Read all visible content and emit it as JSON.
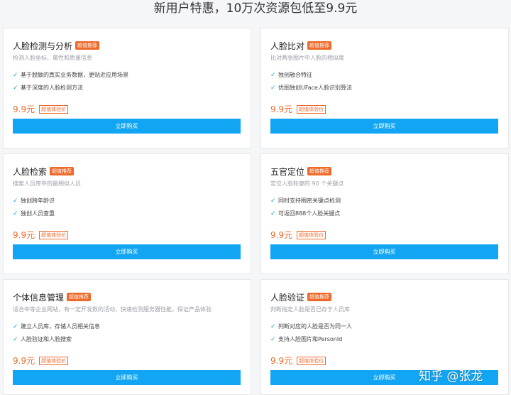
{
  "page": {
    "title": "新用户特惠，10万次资源包低至9.9元"
  },
  "cards": [
    {
      "title": "人脸检测与分析",
      "badge": "超值推荐",
      "subtitle": "检测人脸坐标、属性和质量信息",
      "features": [
        "基于脱敏的真实业务数据，更贴近应用场景",
        "基于深度的人脸检测方法"
      ],
      "price": "9.9元",
      "trial": "超值体验价",
      "button": "立即购买"
    },
    {
      "title": "人脸比对",
      "badge": "超值推荐",
      "subtitle": "比对两张图片中人脸的相似度",
      "features": [
        "独创融合特征",
        "优图独创UFace人脸识别算法"
      ],
      "price": "9.9元",
      "trial": "超值体验价",
      "button": "立即购买"
    },
    {
      "title": "人脸检索",
      "badge": "超值推荐",
      "subtitle": "搜索人员库中的最相似人员",
      "features": [
        "独创跨年龄识",
        "独创人员查重"
      ],
      "price": "9.9元",
      "trial": "超值体验价",
      "button": "立即购买"
    },
    {
      "title": "五官定位",
      "badge": "超值推荐",
      "subtitle": "定位人脸轮廓的 90 个关键点",
      "features": [
        "同时支持稠密关键点检测",
        "可返回888个人脸关键点"
      ],
      "price": "9.9元",
      "trial": "超值体验价",
      "button": "立即购买"
    },
    {
      "title": "个体信息管理",
      "badge": "超值推荐",
      "subtitle": "适合中等企业网站，有一定开发数的活动，快速检测服务器性能，保证产品体验",
      "features": [
        "建立人员库，存储人员相关信息",
        "人脸验证和人脸搜索"
      ],
      "price": "9.9元",
      "trial": "超值体验价",
      "button": "立即购买"
    },
    {
      "title": "人脸验证",
      "badge": "超值推荐",
      "subtitle": "判断指定人脸是否已存于人员库",
      "features": [
        "判断对应的人脸是否为同一人",
        "支持人脸图片和PersonId"
      ],
      "price": "9.9元",
      "trial": "超值体验价",
      "button": "立即购买"
    }
  ],
  "watermark": "知乎 @张龙",
  "colors": {
    "accent": "#12a5f3",
    "badge": "#ec6b2c",
    "price": "#ec6b2c"
  }
}
